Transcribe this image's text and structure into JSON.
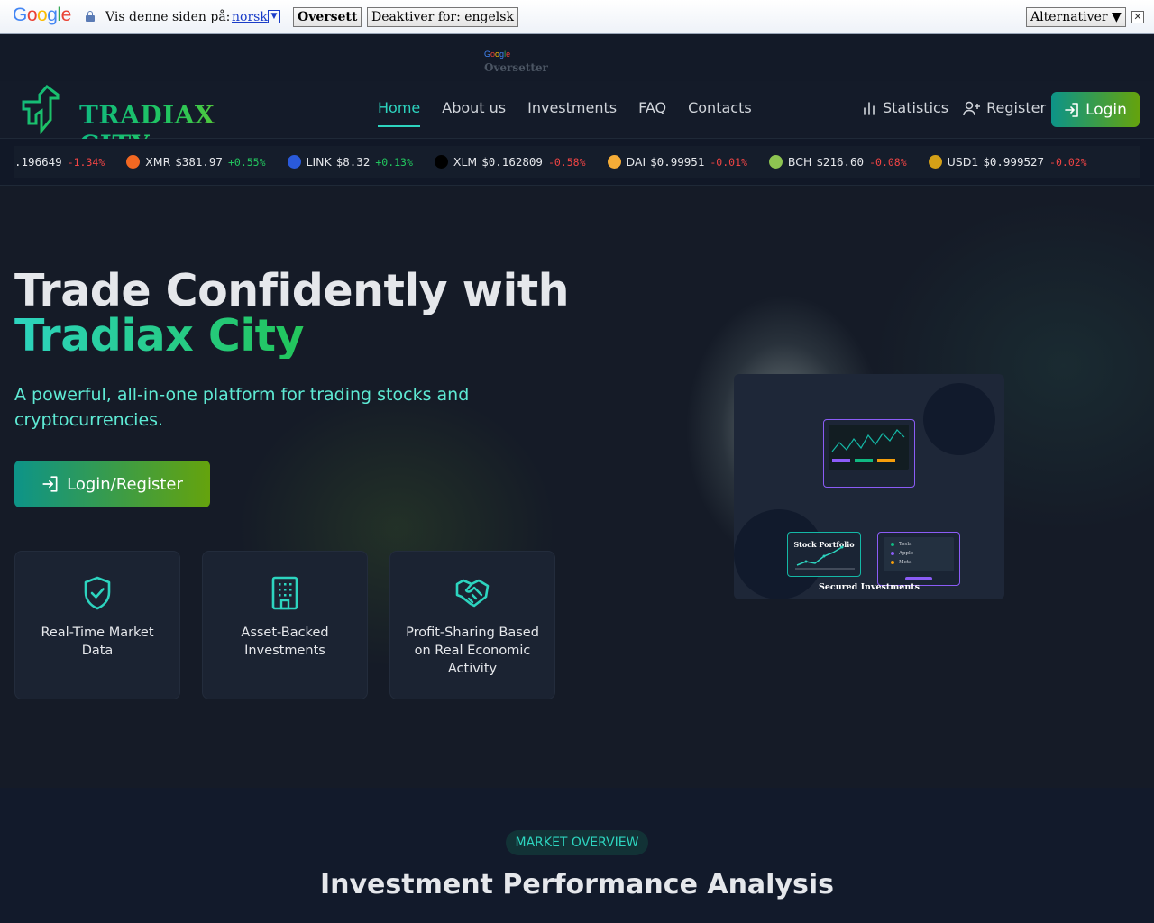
{
  "translate_bar": {
    "logo": "Google",
    "prompt": "Vis denne siden på:",
    "language": "norsk",
    "translate_button": "Oversett",
    "disable_button": "Deaktiver for: engelsk",
    "options_button": "Alternativer ▼",
    "strip_brand": "Google",
    "strip_label": "Oversetter"
  },
  "nav": {
    "logo_text": "TRADIAX CITY",
    "links": [
      "Home",
      "About us",
      "Investments",
      "FAQ",
      "Contacts"
    ],
    "statistics": "Statistics",
    "register": "Register",
    "login": "Login"
  },
  "ticker": [
    {
      "sym": "",
      "price": ".196649",
      "change": "-1.34%",
      "dir": "down",
      "icon": "none",
      "color": ""
    },
    {
      "sym": "XMR",
      "price": "$381.97",
      "change": "+0.55%",
      "dir": "up",
      "icon": "monero-icon",
      "color": "#f26822"
    },
    {
      "sym": "LINK",
      "price": "$8.32",
      "change": "+0.13%",
      "dir": "up",
      "icon": "chainlink-icon",
      "color": "#2a5ada"
    },
    {
      "sym": "XLM",
      "price": "$0.162809",
      "change": "-0.58%",
      "dir": "down",
      "icon": "stellar-icon",
      "color": "#000000"
    },
    {
      "sym": "DAI",
      "price": "$0.99951",
      "change": "-0.01%",
      "dir": "down",
      "icon": "dai-icon",
      "color": "#f5ac37"
    },
    {
      "sym": "BCH",
      "price": "$216.60",
      "change": "-0.08%",
      "dir": "down",
      "icon": "bitcoin-cash-icon",
      "color": "#8dc351"
    },
    {
      "sym": "USD1",
      "price": "$0.999527",
      "change": "-0.02%",
      "dir": "down",
      "icon": "usd1-icon",
      "color": "#d4a017"
    }
  ],
  "hero": {
    "title_line1": "Trade Confidently with",
    "title_line2": "Tradiax City",
    "subtitle": "A powerful, all-in-one platform for trading stocks and cryptocurrencies.",
    "cta": "Login/Register",
    "features": [
      {
        "text": "Real-Time Market Data",
        "icon": "shield-check-icon"
      },
      {
        "text": "Asset-Backed Investments",
        "icon": "building-icon"
      },
      {
        "text": "Profit-Sharing Based on Real Economic Activity",
        "icon": "handshake-icon"
      }
    ],
    "illustration": {
      "card_title": "Stock Portfolio",
      "list": [
        "Tesla",
        "Apple",
        "Meta"
      ],
      "caption": "Secured Investments"
    }
  },
  "market": {
    "pill": "MARKET OVERVIEW",
    "title": "Investment Performance Analysis"
  },
  "colors": {
    "accent": "#2dd4bf",
    "brand_start": "#0d9488",
    "brand_end": "#65a30d",
    "up": "#22c55e",
    "down": "#ef4444"
  }
}
